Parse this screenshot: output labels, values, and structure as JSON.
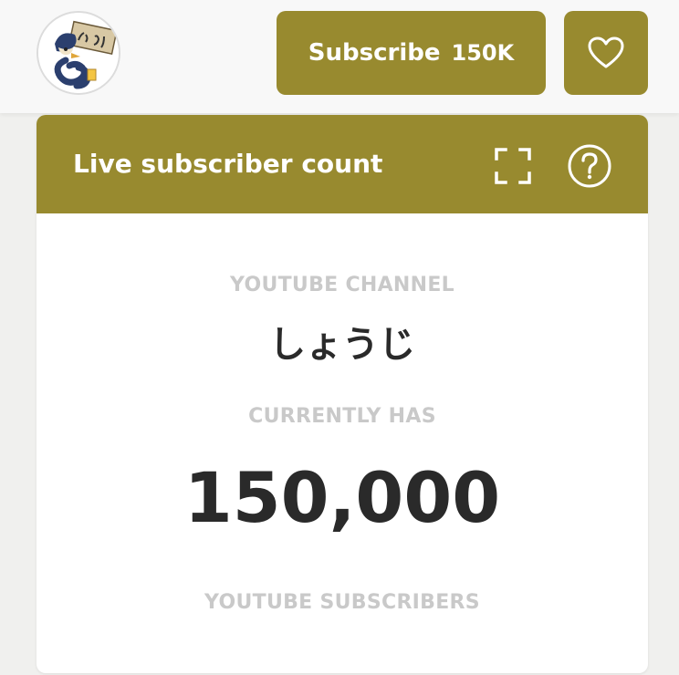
{
  "header": {
    "avatar_alt": "しょうじ",
    "subscribe_label": "Subscribe",
    "subscribe_count": "150K",
    "favorite_icon": "heart-icon"
  },
  "card": {
    "title": "Live subscriber count",
    "fullscreen_icon": "fullscreen-icon",
    "help_icon": "help-circle-icon",
    "channel_label": "YOUTUBE CHANNEL",
    "channel_name": "しょうじ",
    "has_label": "CURRENTLY HAS",
    "subscriber_count": "150,000",
    "subscribers_label": "YOUTUBE SUBSCRIBERS"
  },
  "colors": {
    "accent": "#988a2f",
    "header_bg": "#f8f8f8",
    "page_bg": "#f0f0ee",
    "muted_label": "#c9c9c9",
    "text_dark": "#2a2a2a"
  }
}
